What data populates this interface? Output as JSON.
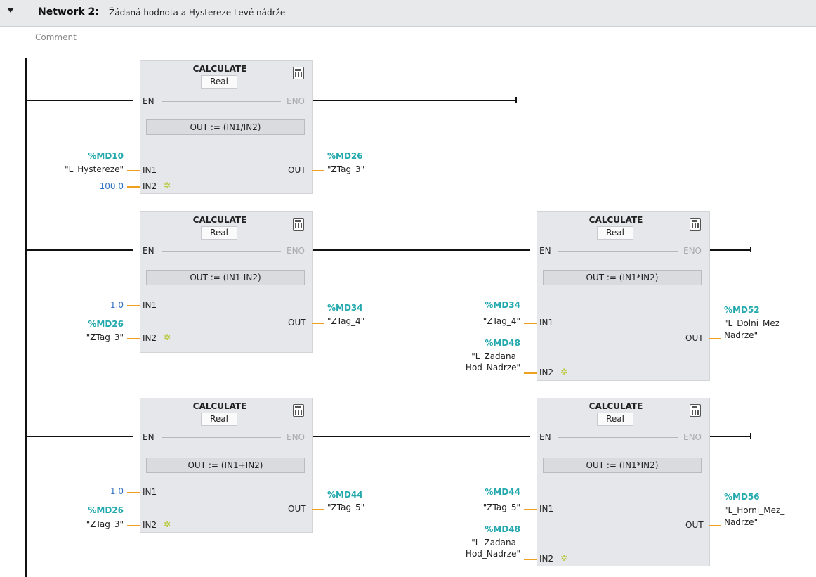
{
  "header": {
    "network": "Network 2:",
    "description": "Žádaná hodnota a Hystereze Levé nádrže"
  },
  "comment": "Comment",
  "common": {
    "block": "CALCULATE",
    "type": "Real",
    "en": "EN",
    "eno": "ENO",
    "out": "OUT",
    "in1": "IN1",
    "in2": "IN2",
    "new_input": "✲"
  },
  "blocks": [
    {
      "id": "b1",
      "formula": "OUT :=  (IN1/IN2)",
      "in1": {
        "addr": "%MD10",
        "tag": "\"L_Hystereze\""
      },
      "in2": {
        "const": "100.0"
      },
      "out": {
        "addr": "%MD26",
        "tag": "\"ZTag_3\""
      }
    },
    {
      "id": "b2",
      "formula": "OUT :=  (IN1-IN2)",
      "in1": {
        "const": "1.0"
      },
      "in2": {
        "addr": "%MD26",
        "tag": "\"ZTag_3\""
      },
      "out": {
        "addr": "%MD34",
        "tag": "\"ZTag_4\""
      }
    },
    {
      "id": "b3",
      "formula": "OUT :=  (IN1*IN2)",
      "in1": {
        "addr": "%MD34",
        "tag": "\"ZTag_4\""
      },
      "in2": {
        "addr": "%MD48",
        "tag1": "\"L_Zadana_",
        "tag2": "Hod_Nadrze\""
      },
      "out": {
        "addr": "%MD52",
        "tag1": "\"L_Dolni_Mez_",
        "tag2": "Nadrze\""
      }
    },
    {
      "id": "b4",
      "formula": "OUT :=  (IN1+IN2)",
      "in1": {
        "const": "1.0"
      },
      "in2": {
        "addr": "%MD26",
        "tag": "\"ZTag_3\""
      },
      "out": {
        "addr": "%MD44",
        "tag": "\"ZTag_5\""
      }
    },
    {
      "id": "b5",
      "formula": "OUT :=  (IN1*IN2)",
      "in1": {
        "addr": "%MD44",
        "tag": "\"ZTag_5\""
      },
      "in2": {
        "addr": "%MD48",
        "tag1": "\"L_Zadana_",
        "tag2": "Hod_Nadrze\""
      },
      "out": {
        "addr": "%MD56",
        "tag1": "\"L_Horni_Mez_",
        "tag2": "Nadrze\""
      }
    }
  ]
}
